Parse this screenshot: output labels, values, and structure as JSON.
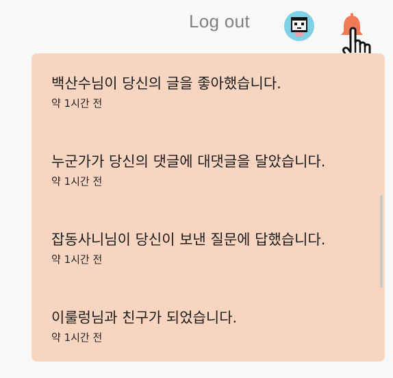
{
  "header": {
    "logout_label": "Log out",
    "avatar_icon": "pixel-face-avatar",
    "bell_icon": "bell-icon",
    "bell_color": "#f07a55"
  },
  "notifications": {
    "background": "#f8d5c0",
    "items": [
      {
        "message": "백산수님이 당신의 글을 좋아했습니다.",
        "time": "약 1시간 전"
      },
      {
        "message": "누군가가 당신의 댓글에 대댓글을 달았습니다.",
        "time": "약 1시간 전"
      },
      {
        "message": "잡동사니님이 당신이 보낸 질문에 답했습니다.",
        "time": "약 1시간 전"
      },
      {
        "message": "이룰렁님과 친구가 되었습니다.",
        "time": "약 1시간 전"
      }
    ]
  }
}
